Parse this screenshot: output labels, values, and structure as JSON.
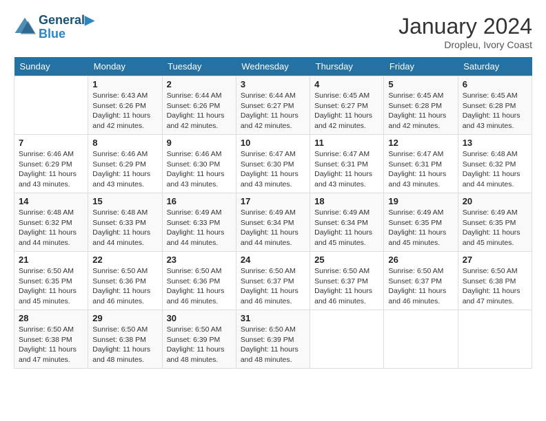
{
  "header": {
    "logo_line1": "General",
    "logo_line2": "Blue",
    "month": "January 2024",
    "location": "Dropleu, Ivory Coast"
  },
  "weekdays": [
    "Sunday",
    "Monday",
    "Tuesday",
    "Wednesday",
    "Thursday",
    "Friday",
    "Saturday"
  ],
  "weeks": [
    [
      {
        "day": "",
        "sunrise": "",
        "sunset": "",
        "daylight": ""
      },
      {
        "day": "1",
        "sunrise": "Sunrise: 6:43 AM",
        "sunset": "Sunset: 6:26 PM",
        "daylight": "Daylight: 11 hours and 42 minutes."
      },
      {
        "day": "2",
        "sunrise": "Sunrise: 6:44 AM",
        "sunset": "Sunset: 6:26 PM",
        "daylight": "Daylight: 11 hours and 42 minutes."
      },
      {
        "day": "3",
        "sunrise": "Sunrise: 6:44 AM",
        "sunset": "Sunset: 6:27 PM",
        "daylight": "Daylight: 11 hours and 42 minutes."
      },
      {
        "day": "4",
        "sunrise": "Sunrise: 6:45 AM",
        "sunset": "Sunset: 6:27 PM",
        "daylight": "Daylight: 11 hours and 42 minutes."
      },
      {
        "day": "5",
        "sunrise": "Sunrise: 6:45 AM",
        "sunset": "Sunset: 6:28 PM",
        "daylight": "Daylight: 11 hours and 42 minutes."
      },
      {
        "day": "6",
        "sunrise": "Sunrise: 6:45 AM",
        "sunset": "Sunset: 6:28 PM",
        "daylight": "Daylight: 11 hours and 43 minutes."
      }
    ],
    [
      {
        "day": "7",
        "sunrise": "Sunrise: 6:46 AM",
        "sunset": "Sunset: 6:29 PM",
        "daylight": "Daylight: 11 hours and 43 minutes."
      },
      {
        "day": "8",
        "sunrise": "Sunrise: 6:46 AM",
        "sunset": "Sunset: 6:29 PM",
        "daylight": "Daylight: 11 hours and 43 minutes."
      },
      {
        "day": "9",
        "sunrise": "Sunrise: 6:46 AM",
        "sunset": "Sunset: 6:30 PM",
        "daylight": "Daylight: 11 hours and 43 minutes."
      },
      {
        "day": "10",
        "sunrise": "Sunrise: 6:47 AM",
        "sunset": "Sunset: 6:30 PM",
        "daylight": "Daylight: 11 hours and 43 minutes."
      },
      {
        "day": "11",
        "sunrise": "Sunrise: 6:47 AM",
        "sunset": "Sunset: 6:31 PM",
        "daylight": "Daylight: 11 hours and 43 minutes."
      },
      {
        "day": "12",
        "sunrise": "Sunrise: 6:47 AM",
        "sunset": "Sunset: 6:31 PM",
        "daylight": "Daylight: 11 hours and 43 minutes."
      },
      {
        "day": "13",
        "sunrise": "Sunrise: 6:48 AM",
        "sunset": "Sunset: 6:32 PM",
        "daylight": "Daylight: 11 hours and 44 minutes."
      }
    ],
    [
      {
        "day": "14",
        "sunrise": "Sunrise: 6:48 AM",
        "sunset": "Sunset: 6:32 PM",
        "daylight": "Daylight: 11 hours and 44 minutes."
      },
      {
        "day": "15",
        "sunrise": "Sunrise: 6:48 AM",
        "sunset": "Sunset: 6:33 PM",
        "daylight": "Daylight: 11 hours and 44 minutes."
      },
      {
        "day": "16",
        "sunrise": "Sunrise: 6:49 AM",
        "sunset": "Sunset: 6:33 PM",
        "daylight": "Daylight: 11 hours and 44 minutes."
      },
      {
        "day": "17",
        "sunrise": "Sunrise: 6:49 AM",
        "sunset": "Sunset: 6:34 PM",
        "daylight": "Daylight: 11 hours and 44 minutes."
      },
      {
        "day": "18",
        "sunrise": "Sunrise: 6:49 AM",
        "sunset": "Sunset: 6:34 PM",
        "daylight": "Daylight: 11 hours and 45 minutes."
      },
      {
        "day": "19",
        "sunrise": "Sunrise: 6:49 AM",
        "sunset": "Sunset: 6:35 PM",
        "daylight": "Daylight: 11 hours and 45 minutes."
      },
      {
        "day": "20",
        "sunrise": "Sunrise: 6:49 AM",
        "sunset": "Sunset: 6:35 PM",
        "daylight": "Daylight: 11 hours and 45 minutes."
      }
    ],
    [
      {
        "day": "21",
        "sunrise": "Sunrise: 6:50 AM",
        "sunset": "Sunset: 6:35 PM",
        "daylight": "Daylight: 11 hours and 45 minutes."
      },
      {
        "day": "22",
        "sunrise": "Sunrise: 6:50 AM",
        "sunset": "Sunset: 6:36 PM",
        "daylight": "Daylight: 11 hours and 46 minutes."
      },
      {
        "day": "23",
        "sunrise": "Sunrise: 6:50 AM",
        "sunset": "Sunset: 6:36 PM",
        "daylight": "Daylight: 11 hours and 46 minutes."
      },
      {
        "day": "24",
        "sunrise": "Sunrise: 6:50 AM",
        "sunset": "Sunset: 6:37 PM",
        "daylight": "Daylight: 11 hours and 46 minutes."
      },
      {
        "day": "25",
        "sunrise": "Sunrise: 6:50 AM",
        "sunset": "Sunset: 6:37 PM",
        "daylight": "Daylight: 11 hours and 46 minutes."
      },
      {
        "day": "26",
        "sunrise": "Sunrise: 6:50 AM",
        "sunset": "Sunset: 6:37 PM",
        "daylight": "Daylight: 11 hours and 46 minutes."
      },
      {
        "day": "27",
        "sunrise": "Sunrise: 6:50 AM",
        "sunset": "Sunset: 6:38 PM",
        "daylight": "Daylight: 11 hours and 47 minutes."
      }
    ],
    [
      {
        "day": "28",
        "sunrise": "Sunrise: 6:50 AM",
        "sunset": "Sunset: 6:38 PM",
        "daylight": "Daylight: 11 hours and 47 minutes."
      },
      {
        "day": "29",
        "sunrise": "Sunrise: 6:50 AM",
        "sunset": "Sunset: 6:38 PM",
        "daylight": "Daylight: 11 hours and 48 minutes."
      },
      {
        "day": "30",
        "sunrise": "Sunrise: 6:50 AM",
        "sunset": "Sunset: 6:39 PM",
        "daylight": "Daylight: 11 hours and 48 minutes."
      },
      {
        "day": "31",
        "sunrise": "Sunrise: 6:50 AM",
        "sunset": "Sunset: 6:39 PM",
        "daylight": "Daylight: 11 hours and 48 minutes."
      },
      {
        "day": "",
        "sunrise": "",
        "sunset": "",
        "daylight": ""
      },
      {
        "day": "",
        "sunrise": "",
        "sunset": "",
        "daylight": ""
      },
      {
        "day": "",
        "sunrise": "",
        "sunset": "",
        "daylight": ""
      }
    ]
  ]
}
